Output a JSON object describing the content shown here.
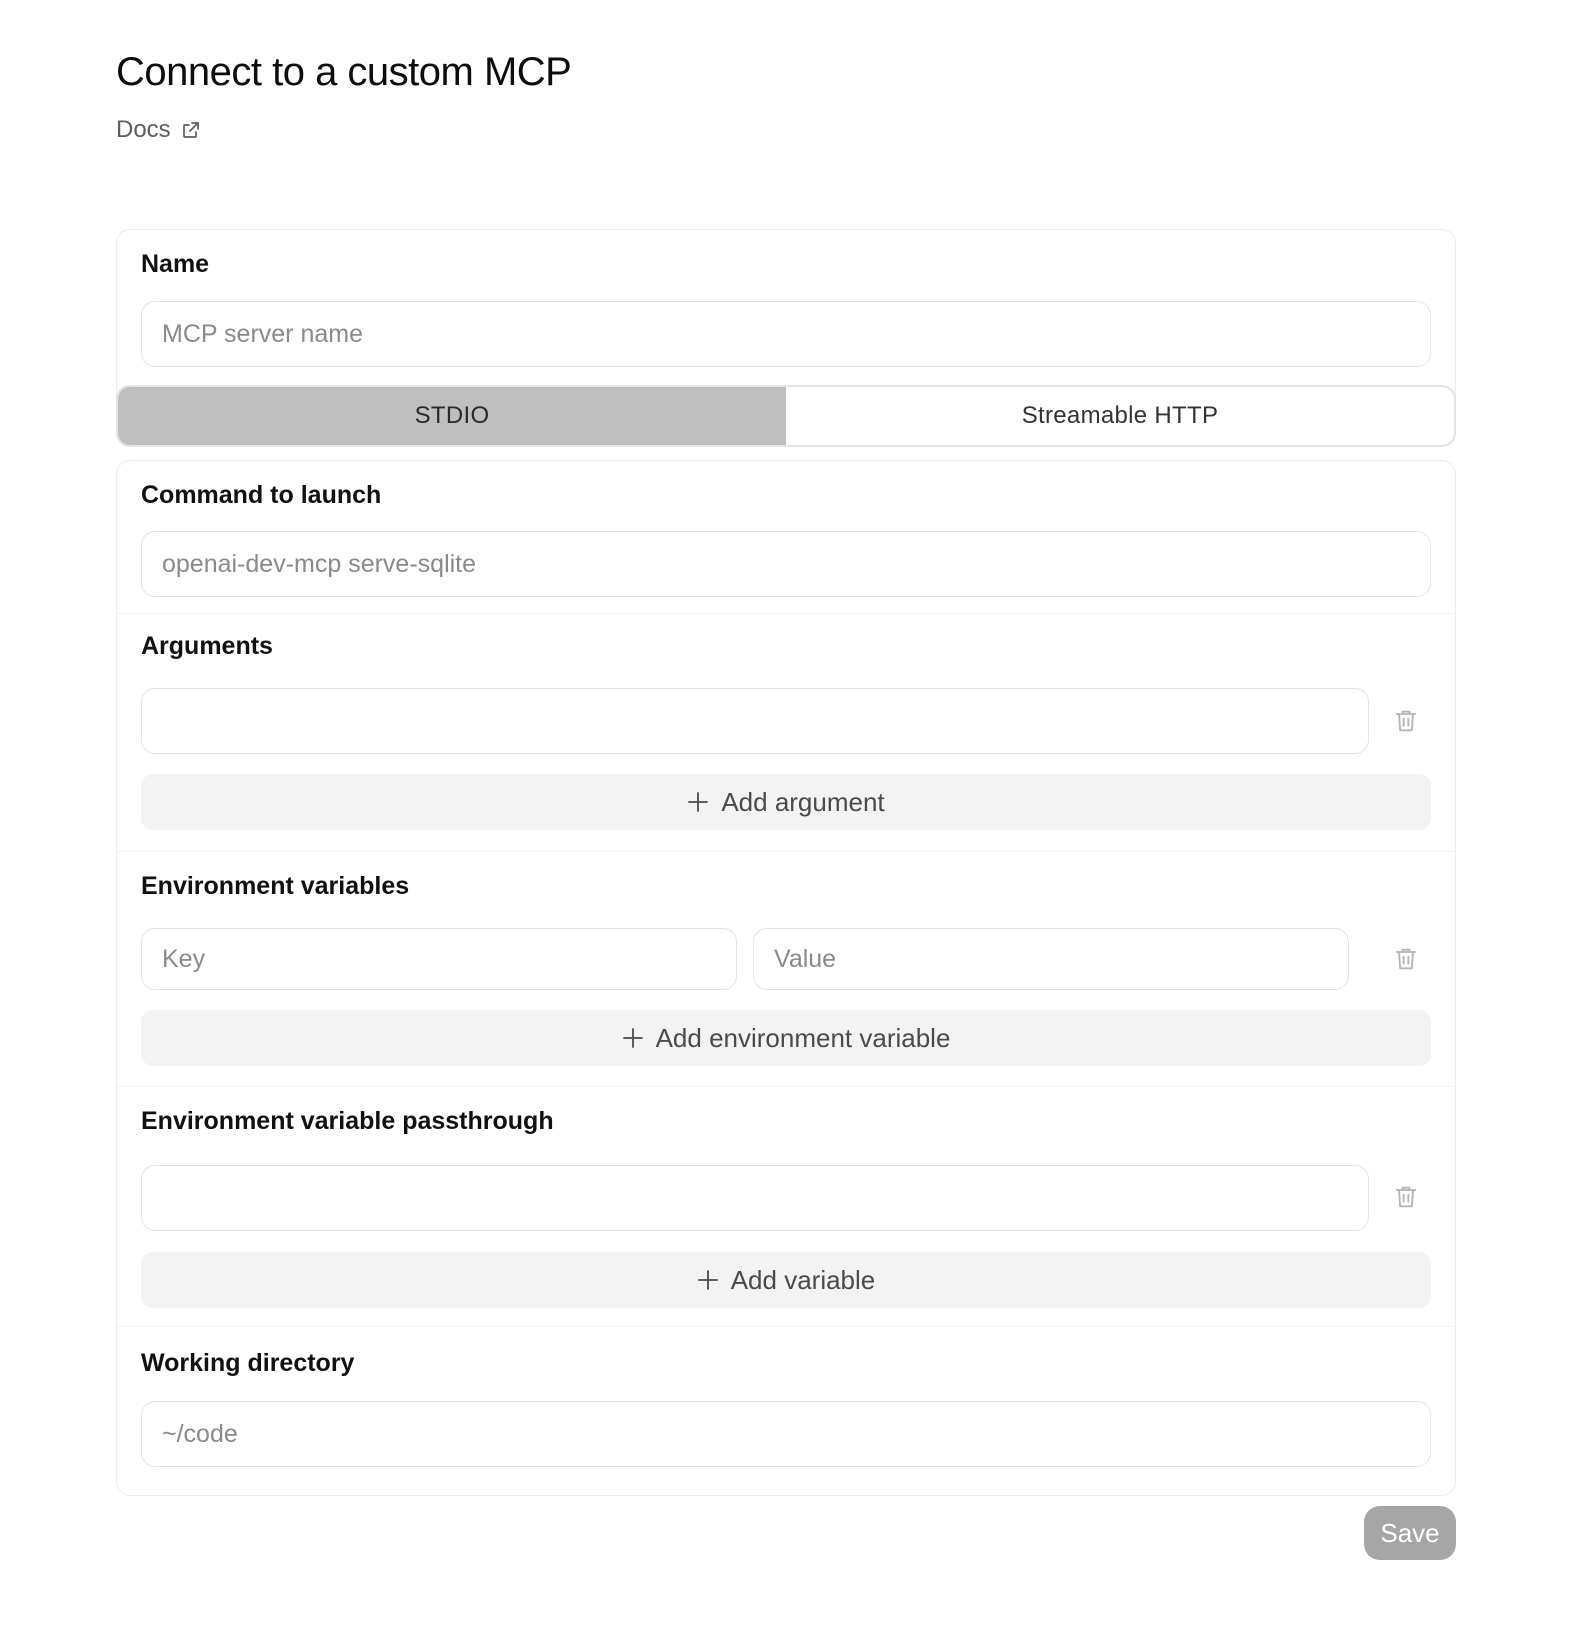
{
  "header": {
    "title": "Connect to a custom MCP",
    "docs_label": "Docs"
  },
  "name_section": {
    "label": "Name",
    "placeholder": "MCP server name",
    "value": ""
  },
  "transport": {
    "options": [
      "STDIO",
      "Streamable HTTP"
    ],
    "selected": "STDIO"
  },
  "command_section": {
    "label": "Command to launch",
    "placeholder": "openai-dev-mcp serve-sqlite",
    "value": ""
  },
  "arguments_section": {
    "label": "Arguments",
    "argument_value": "",
    "add_label": "Add argument"
  },
  "env_section": {
    "label": "Environment variables",
    "key_placeholder": "Key",
    "value_placeholder": "Value",
    "add_label": "Add environment variable"
  },
  "passthrough_section": {
    "label": "Environment variable passthrough",
    "variable_value": "",
    "add_label": "Add variable"
  },
  "workdir_section": {
    "label": "Working directory",
    "placeholder": "~/code",
    "value": ""
  },
  "footer": {
    "save_label": "Save"
  },
  "colors": {
    "selected_tab": "#bfbfbf",
    "save_button": "#a6a6a6",
    "add_button_bg": "#f3f3f3",
    "border": "#e3e3e3"
  },
  "icons": {
    "docs": "external-link-icon",
    "delete": "trash-icon",
    "add": "plus-icon"
  }
}
